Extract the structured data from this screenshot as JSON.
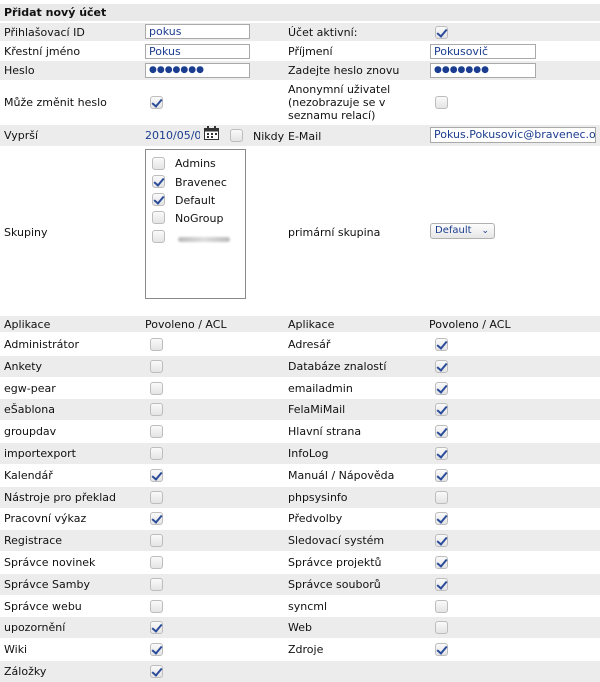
{
  "section_title": "Přidat nový účet",
  "form": {
    "login_label": "Přihlašovací ID",
    "login_value": "pokus",
    "active_label": "Účet aktivní:",
    "firstname_label": "Křestní jméno",
    "firstname_value": "Pokus",
    "lastname_label": "Příjmení",
    "lastname_value": "Pokusovič",
    "password_label": "Heslo",
    "password_value": "●●●●●●●",
    "password2_label": "Zadejte heslo znovu",
    "password2_value": "●●●●●●●",
    "can_change_pw_label": "Může změnit heslo",
    "anonymous_label_1": "Anonymní uživatel",
    "anonymous_label_2": "(nezobrazuje se v",
    "anonymous_label_3": "seznamu relací)",
    "expires_label": "Vyprší",
    "expires_value": "2010/05/0",
    "never_label": "Nikdy",
    "email_label": "E-Mail",
    "email_value": "Pokus.Pokusovic@bravenec.oi",
    "groups_label": "Skupiny",
    "groups": [
      {
        "name": "Admins",
        "checked": false
      },
      {
        "name": "Bravenec",
        "checked": true
      },
      {
        "name": "Default",
        "checked": true
      },
      {
        "name": "NoGroup",
        "checked": false
      }
    ],
    "primary_group_label": "primární skupina",
    "primary_group_value": "Default"
  },
  "apps_table": {
    "col_app": "Aplikace",
    "col_acl": "Povoleno / ACL",
    "left": [
      {
        "name": "Administrátor",
        "checked": false
      },
      {
        "name": "Ankety",
        "checked": false
      },
      {
        "name": "egw-pear",
        "checked": false
      },
      {
        "name": "eŠablona",
        "checked": false
      },
      {
        "name": "groupdav",
        "checked": false
      },
      {
        "name": "importexport",
        "checked": false
      },
      {
        "name": "Kalendář",
        "checked": true
      },
      {
        "name": "Nástroje pro překlad",
        "checked": false
      },
      {
        "name": "Pracovní výkaz",
        "checked": true
      },
      {
        "name": "Registrace",
        "checked": false
      },
      {
        "name": "Správce novinek",
        "checked": false
      },
      {
        "name": "Správce Samby",
        "checked": false
      },
      {
        "name": "Správce webu",
        "checked": false
      },
      {
        "name": "upozornění",
        "checked": true
      },
      {
        "name": "Wiki",
        "checked": true
      },
      {
        "name": "Záložky",
        "checked": true
      }
    ],
    "right": [
      {
        "name": "Adresář",
        "checked": true
      },
      {
        "name": "Databáze znalostí",
        "checked": true
      },
      {
        "name": "emailadmin",
        "checked": true
      },
      {
        "name": "FelaMiMail",
        "checked": true
      },
      {
        "name": "Hlavní strana",
        "checked": true
      },
      {
        "name": "InfoLog",
        "checked": true
      },
      {
        "name": "Manuál / Nápověda",
        "checked": true
      },
      {
        "name": "phpsysinfo",
        "checked": false
      },
      {
        "name": "Předvolby",
        "checked": true
      },
      {
        "name": "Sledovací systém",
        "checked": true
      },
      {
        "name": "Správce projektů",
        "checked": true
      },
      {
        "name": "Správce souborů",
        "checked": true
      },
      {
        "name": "syncml",
        "checked": false
      },
      {
        "name": "Web",
        "checked": false
      },
      {
        "name": "Zdroje",
        "checked": true
      }
    ]
  }
}
